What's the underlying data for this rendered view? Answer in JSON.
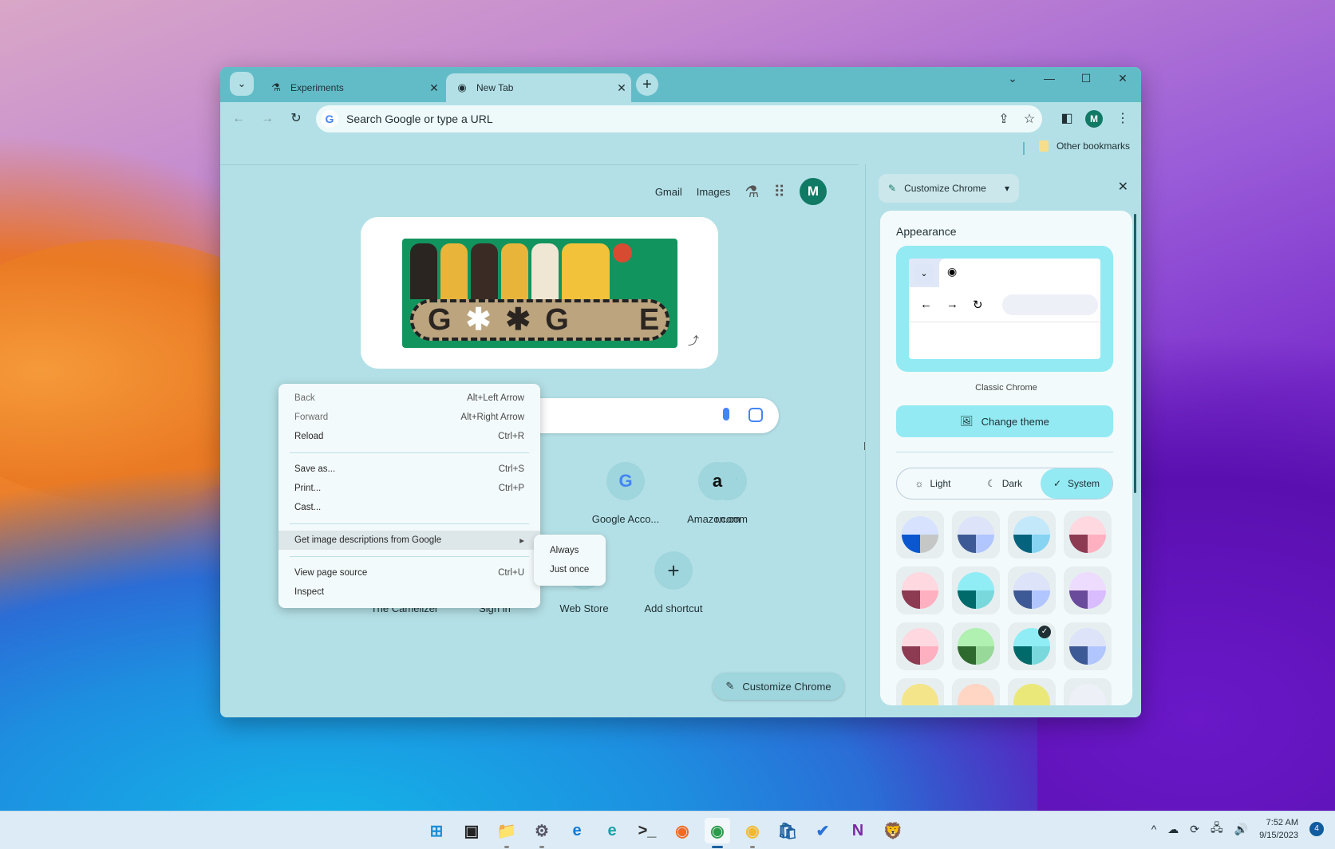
{
  "browser": {
    "tabs": [
      {
        "label": "Experiments",
        "icon": "flask-icon",
        "active": false
      },
      {
        "label": "New Tab",
        "icon": "chrome-icon",
        "active": true
      }
    ],
    "tab_close_glyph": "✕",
    "new_tab_glyph": "+",
    "tab_search_glyph": "⌄",
    "window_controls": {
      "tab_list": "⌄",
      "minimize": "—",
      "maximize": "☐",
      "close": "✕"
    },
    "nav": {
      "back": "←",
      "forward": "→",
      "reload": "↻"
    },
    "omnibox": {
      "placeholder": "Search Google or type a URL",
      "google_glyph": "G",
      "share_glyph": "⇪",
      "star_glyph": "☆"
    },
    "side_panel_glyph": "◧",
    "profile_initial": "M",
    "menu_glyph": "⋮",
    "bookmarks": {
      "other_label": "Other bookmarks"
    }
  },
  "newtab": {
    "top_links": {
      "gmail": "Gmail",
      "images": "Images",
      "labs_glyph": "⚗",
      "apps_glyph": "⠿",
      "avatar_initial": "M"
    },
    "doodle": {
      "text": [
        "G",
        "✱",
        "✱",
        "G",
        "",
        "E"
      ],
      "share_glyph": "⤴"
    },
    "search": {
      "mic": "voice-search",
      "lens": "image-search"
    },
    "shortcuts": [
      {
        "label": "r.com",
        "glyph": "🐦",
        "icon": "twitter-icon"
      },
      {
        "label": "Google Acco...",
        "glyph": "G",
        "icon": "google-icon"
      },
      {
        "label": "Amazon.com",
        "glyph": "a",
        "icon": "amazon-icon"
      },
      {
        "label": "The Camelizer",
        "glyph": "",
        "icon": "camelizer-icon"
      },
      {
        "label": "Sign in",
        "glyph": "",
        "icon": "signin-icon"
      },
      {
        "label": "Web Store",
        "glyph": "",
        "icon": "webstore-icon"
      },
      {
        "label": "Add shortcut",
        "glyph": "+",
        "icon": "plus-icon"
      }
    ],
    "customize_button": {
      "label": "Customize Chrome",
      "glyph": "✎"
    },
    "resize_handle": "‖"
  },
  "context_menu": {
    "items": [
      {
        "label": "Back",
        "shortcut": "Alt+Left Arrow",
        "disabled": true
      },
      {
        "label": "Forward",
        "shortcut": "Alt+Right Arrow",
        "disabled": true
      },
      {
        "label": "Reload",
        "shortcut": "Ctrl+R",
        "disabled": false
      },
      {
        "label": "Save as...",
        "shortcut": "Ctrl+S",
        "disabled": false
      },
      {
        "label": "Print...",
        "shortcut": "Ctrl+P",
        "disabled": false
      },
      {
        "label": "Cast...",
        "shortcut": "",
        "disabled": false
      },
      {
        "label": "Get image descriptions from Google",
        "shortcut": "▸",
        "disabled": false,
        "highlighted": true
      },
      {
        "label": "View page source",
        "shortcut": "Ctrl+U",
        "disabled": false
      },
      {
        "label": "Inspect",
        "shortcut": "",
        "disabled": false
      }
    ],
    "submenu": [
      "Always",
      "Just once"
    ]
  },
  "side_panel": {
    "header": {
      "label": "Customize Chrome",
      "pencil_glyph": "✎",
      "dropdown_glyph": "▾",
      "close_glyph": "✕"
    },
    "appearance_title": "Appearance",
    "preview": {
      "dropdown_glyph": "⌄",
      "chrome_glyph": "◉",
      "back": "←",
      "forward": "→",
      "reload": "↻"
    },
    "theme_name": "Classic Chrome",
    "change_theme": {
      "label": "Change theme",
      "glyph": "🖼"
    },
    "modes": [
      {
        "label": "Light",
        "glyph": "☼",
        "selected": false
      },
      {
        "label": "Dark",
        "glyph": "☾",
        "selected": false
      },
      {
        "label": "System",
        "glyph": "✓",
        "selected": true
      }
    ],
    "swatches": [
      {
        "top": "#d6e2ff",
        "bl": "#0b57d0",
        "br": "#c4c7c5",
        "selected": false
      },
      {
        "top": "#dde3f8",
        "bl": "#3e5a96",
        "br": "#b1c5ff",
        "selected": false
      },
      {
        "top": "#c2e8fa",
        "bl": "#05637e",
        "br": "#86d3f2",
        "selected": false
      },
      {
        "top": "#ffd8e0",
        "bl": "#8c3b53",
        "br": "#ffb0c0",
        "selected": false
      },
      {
        "top": "#ffd8e0",
        "bl": "#8c3b53",
        "br": "#ffb0c0",
        "selected": false
      },
      {
        "top": "#90edf5",
        "bl": "#006a6a",
        "br": "#78d8dc",
        "selected": false
      },
      {
        "top": "#dde3f8",
        "bl": "#3e5a96",
        "br": "#b1c5ff",
        "selected": false
      },
      {
        "top": "#eedcff",
        "bl": "#6a4a9a",
        "br": "#d8bcff",
        "selected": false
      },
      {
        "top": "#ffd8e0",
        "bl": "#8c3b53",
        "br": "#ffb0c0",
        "selected": false
      },
      {
        "top": "#b0f0b0",
        "bl": "#2e6a2e",
        "br": "#98d898",
        "selected": false
      },
      {
        "top": "#90edf5",
        "bl": "#006a6a",
        "br": "#78d8dc",
        "selected": true
      },
      {
        "top": "#dde3f8",
        "bl": "#3e5a96",
        "br": "#b1c5ff",
        "selected": false
      },
      {
        "top": "#f5e58a",
        "bl": "#f5e58a",
        "br": "#f5e58a",
        "selected": false
      },
      {
        "top": "#ffd6c4",
        "bl": "#ffd6c4",
        "br": "#ffd6c4",
        "selected": false
      },
      {
        "top": "#ebe87a",
        "bl": "#ebe87a",
        "br": "#ebe87a",
        "selected": false
      },
      {
        "top": "#eef0f8",
        "bl": "#eef0f8",
        "br": "#eef0f8",
        "selected": false
      }
    ],
    "check_glyph": "✓"
  },
  "taskbar": {
    "apps": [
      {
        "name": "start",
        "glyph": "⊞",
        "color": "#1a8fd8",
        "pinned_open": false,
        "active": false
      },
      {
        "name": "task-view",
        "glyph": "▣",
        "color": "#222",
        "pinned_open": false,
        "active": false
      },
      {
        "name": "file-explorer",
        "glyph": "📁",
        "color": "#f2c12e",
        "pinned_open": true,
        "active": false
      },
      {
        "name": "settings",
        "glyph": "⚙",
        "color": "#556",
        "pinned_open": true,
        "active": false
      },
      {
        "name": "edge",
        "glyph": "e",
        "color": "#0f7ad8",
        "pinned_open": false,
        "active": false
      },
      {
        "name": "edge-canary",
        "glyph": "e",
        "color": "#1aa0a8",
        "pinned_open": false,
        "active": false
      },
      {
        "name": "terminal",
        "glyph": ">_",
        "color": "#2b2b2b",
        "pinned_open": false,
        "active": false
      },
      {
        "name": "firefox",
        "glyph": "◉",
        "color": "#f06a25",
        "pinned_open": false,
        "active": false
      },
      {
        "name": "chrome",
        "glyph": "◉",
        "color": "#2d9c4a",
        "pinned_open": true,
        "active": true
      },
      {
        "name": "chrome-canary",
        "glyph": "◉",
        "color": "#f2b92e",
        "pinned_open": true,
        "active": false
      },
      {
        "name": "store",
        "glyph": "🛍",
        "color": "#1a5fa0",
        "pinned_open": false,
        "active": false
      },
      {
        "name": "todo",
        "glyph": "✔",
        "color": "#2872d8",
        "pinned_open": false,
        "active": false
      },
      {
        "name": "onenote",
        "glyph": "N",
        "color": "#7a2aa8",
        "pinned_open": false,
        "active": false
      },
      {
        "name": "brave",
        "glyph": "🦁",
        "color": "#f0522a",
        "pinned_open": false,
        "active": false
      }
    ],
    "tray": {
      "chevron": "^",
      "cloud": "☁",
      "sync": "⟳",
      "network": "🖧",
      "volume": "🔊"
    },
    "time": "7:52 AM",
    "date": "9/15/2023",
    "notifications": "4"
  }
}
